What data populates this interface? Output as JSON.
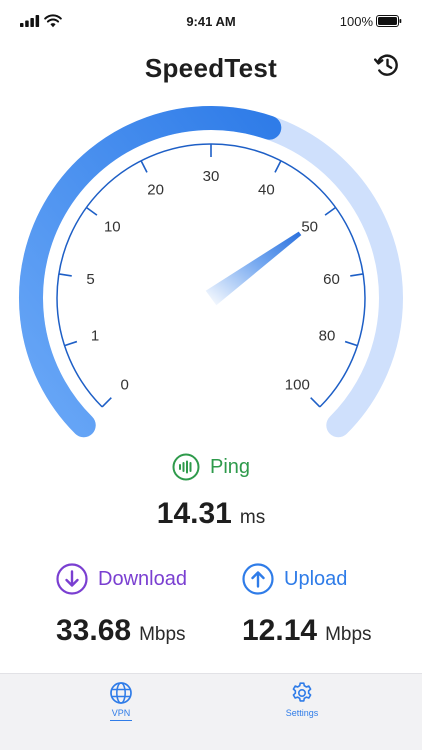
{
  "status_bar": {
    "time": "9:41 AM",
    "battery_percent": "100%",
    "icons": [
      "signal-icon",
      "wifi-icon",
      "battery-icon"
    ]
  },
  "header": {
    "title": "SpeedTest",
    "history_icon": "history-icon"
  },
  "gauge": {
    "tick_labels": [
      "0",
      "1",
      "5",
      "10",
      "20",
      "30",
      "40",
      "50",
      "60",
      "80",
      "100"
    ],
    "needle_value": 50,
    "progress_fraction": 0.57,
    "colors": {
      "arc_active": "#2f7ce8",
      "arc_active_light": "#6aa8f7",
      "arc_track": "#cfe0fc",
      "scale": "#1e5fc6"
    }
  },
  "ping": {
    "label": "Ping",
    "value": "14.31",
    "unit": "ms",
    "icon": "ping-icon",
    "color": "#2e9a4b"
  },
  "download": {
    "label": "Download",
    "value": "33.68",
    "unit": "Mbps",
    "icon": "download-icon",
    "color": "#7a3fd1"
  },
  "upload": {
    "label": "Upload",
    "value": "12.14",
    "unit": "Mbps",
    "icon": "upload-icon",
    "color": "#2f7ce8"
  },
  "tab_bar": {
    "tabs": [
      {
        "label": "VPN",
        "icon": "globe-icon",
        "selected": true
      },
      {
        "label": "Settings",
        "icon": "gear-icon",
        "selected": false
      }
    ]
  }
}
